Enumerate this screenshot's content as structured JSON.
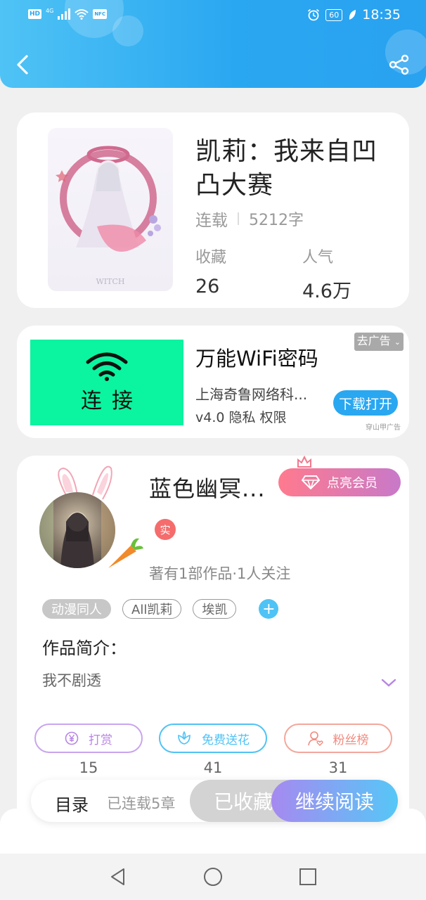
{
  "status_bar": {
    "hd": "HD",
    "network": "4G",
    "nfc": "NFC",
    "battery": "60",
    "time": "18:35"
  },
  "colors": {
    "header_blue": "#29a2f0",
    "accent_purple": "#b884e6",
    "accent_cyan": "#4fc3f5",
    "accent_red": "#f56c6c",
    "ad_green": "#0bf49f"
  },
  "icons": {
    "back": "back-arrow-icon",
    "share": "share-icon",
    "wifi": "wifi-icon",
    "diamond": "diamond-icon",
    "crown": "crown-icon",
    "yen": "yen-icon",
    "flower": "flower-icon",
    "fans": "user-heart-icon",
    "expand": "chevron-down-icon"
  },
  "book": {
    "title": "凯莉：我来自凹凸大赛",
    "status": "连载",
    "word_count": "5212字",
    "favorites_label": "收藏",
    "favorites_value": "26",
    "popularity_label": "人气",
    "popularity_value": "4.6万",
    "cover_text": "WITCH"
  },
  "ad": {
    "image_text": "连接",
    "title": "万能WiFi密码",
    "close_label": "去广告",
    "company": "上海奇鲁网络科...",
    "version": "v4.0 隐私 权限",
    "download_label": "下载打开",
    "source": "穿山甲广告"
  },
  "author": {
    "name": "蓝色幽冥...",
    "vip_label": "点亮会员",
    "verified_label": "实",
    "stats": "著有1部作品·1人关注",
    "tags": [
      "动漫同人",
      "All凯莉",
      "埃凯"
    ],
    "add_tag": "+",
    "intro_heading": "作品简介：",
    "intro_text": "我不剧透"
  },
  "actions": [
    {
      "label": "打赏",
      "count": "15",
      "color": "#b884e6"
    },
    {
      "label": "免费送花",
      "count": "41",
      "color": "#4fc3f5"
    },
    {
      "label": "粉丝榜",
      "count": "31",
      "color": "#f08a7e"
    }
  ],
  "bottom_bar": {
    "catalog": "目录",
    "chapters": "已连载5章",
    "favorited": "已收藏",
    "continue_reading": "继续阅读"
  }
}
